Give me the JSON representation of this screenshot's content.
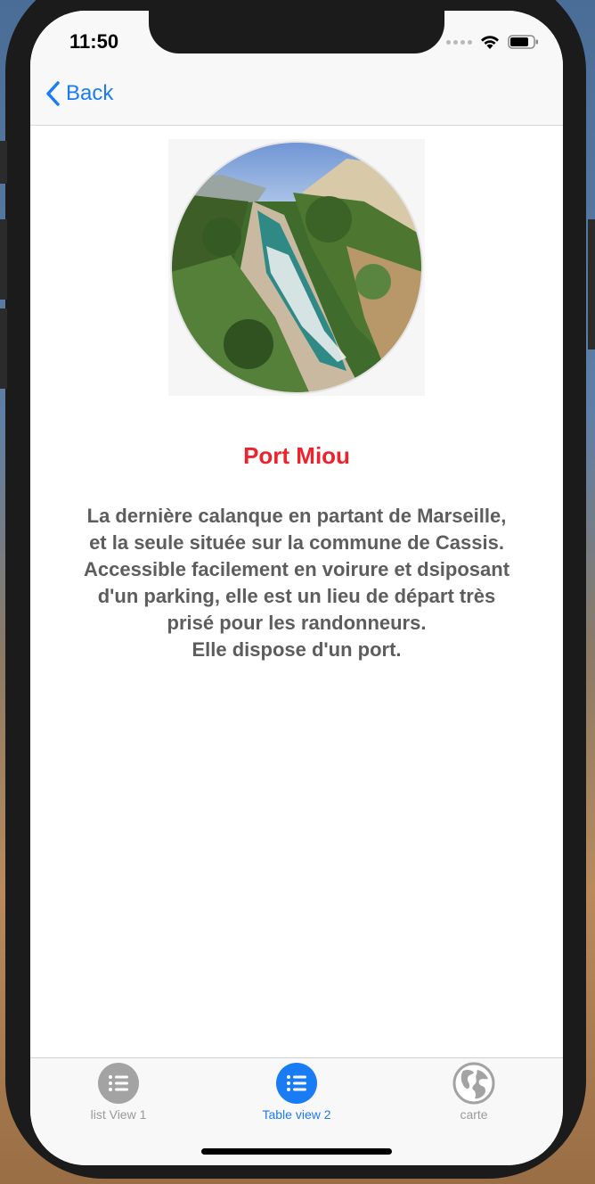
{
  "status_bar": {
    "time": "11:50"
  },
  "nav": {
    "back_label": "Back",
    "accent_color": "#1a7cf5"
  },
  "detail": {
    "title": "Port Miou",
    "title_color": "#f0222c",
    "description": "La dernière calanque en partant de Marseille,\net la seule située sur la commune de Cassis.\nAccessible facilement en voirure et dsiposant\nd'un parking, elle est un lieu de départ très\nprisé pour les randonneurs.\nElle dispose d'un port."
  },
  "tabs": [
    {
      "label": "list View 1",
      "icon": "list-icon",
      "active": false
    },
    {
      "label": "Table view 2",
      "icon": "list-icon",
      "active": true
    },
    {
      "label": "carte",
      "icon": "globe-icon",
      "active": false
    }
  ]
}
